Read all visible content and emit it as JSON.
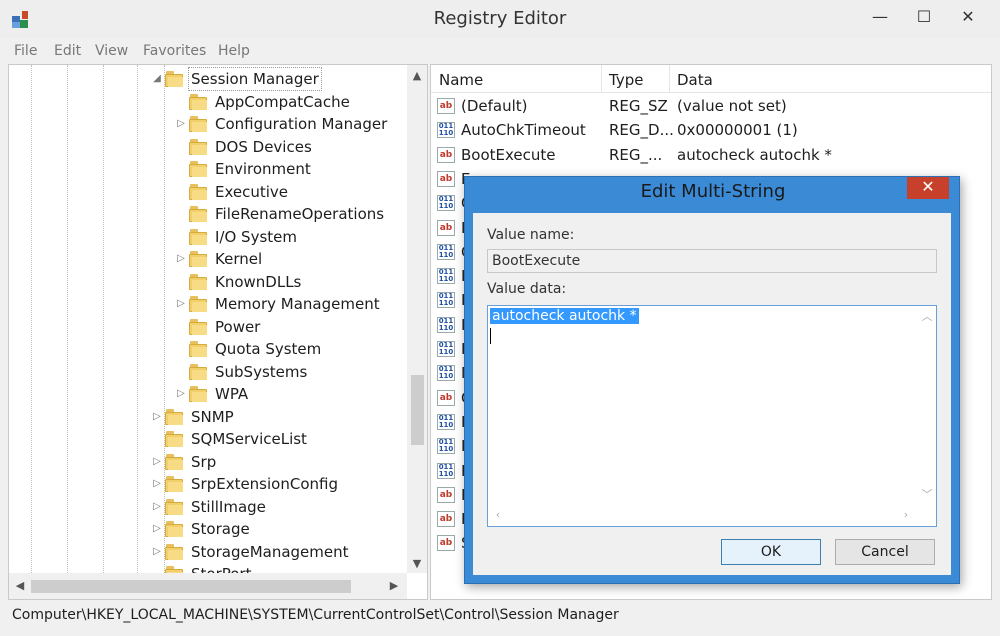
{
  "window": {
    "title": "Registry Editor",
    "minimize_glyph": "—",
    "maximize_glyph": "☐",
    "close_glyph": "✕"
  },
  "menu": [
    "File",
    "Edit",
    "View",
    "Favorites",
    "Help"
  ],
  "tree": {
    "selected": "Session Manager",
    "items": [
      {
        "label": "Session Manager",
        "expanded": true,
        "level": 1
      },
      {
        "label": "AppCompatCache",
        "level": 2,
        "has_children": false
      },
      {
        "label": "Configuration Manager",
        "level": 2,
        "has_children": true
      },
      {
        "label": "DOS Devices",
        "level": 2,
        "has_children": false
      },
      {
        "label": "Environment",
        "level": 2,
        "has_children": false
      },
      {
        "label": "Executive",
        "level": 2,
        "has_children": false
      },
      {
        "label": "FileRenameOperations",
        "level": 2,
        "has_children": false
      },
      {
        "label": "I/O System",
        "level": 2,
        "has_children": false
      },
      {
        "label": "Kernel",
        "level": 2,
        "has_children": true
      },
      {
        "label": "KnownDLLs",
        "level": 2,
        "has_children": false
      },
      {
        "label": "Memory Management",
        "level": 2,
        "has_children": true
      },
      {
        "label": "Power",
        "level": 2,
        "has_children": false
      },
      {
        "label": "Quota System",
        "level": 2,
        "has_children": false
      },
      {
        "label": "SubSystems",
        "level": 2,
        "has_children": false
      },
      {
        "label": "WPA",
        "level": 2,
        "has_children": true
      },
      {
        "label": "SNMP",
        "level": 1,
        "has_children": true
      },
      {
        "label": "SQMServiceList",
        "level": 1,
        "has_children": false
      },
      {
        "label": "Srp",
        "level": 1,
        "has_children": true
      },
      {
        "label": "SrpExtensionConfig",
        "level": 1,
        "has_children": true
      },
      {
        "label": "StillImage",
        "level": 1,
        "has_children": true
      },
      {
        "label": "Storage",
        "level": 1,
        "has_children": true
      },
      {
        "label": "StorageManagement",
        "level": 1,
        "has_children": true
      },
      {
        "label": "StorPort",
        "level": 1,
        "has_children": false
      }
    ]
  },
  "list": {
    "columns": [
      "Name",
      "Type",
      "Data"
    ],
    "rows": [
      {
        "name": "(Default)",
        "type": "REG_SZ",
        "data": "(value not set)",
        "icon": "string-value-icon"
      },
      {
        "name": "AutoChkTimeout",
        "type": "REG_D...",
        "data": "0x00000001 (1)",
        "icon": "binary-value-icon"
      },
      {
        "name": "BootExecute",
        "type": "REG_...",
        "data": "autocheck autochk *",
        "icon": "string-value-icon"
      },
      {
        "name": "E",
        "type": "",
        "data": "",
        "icon": "string-value-icon"
      },
      {
        "name": "C",
        "type": "",
        "data": "",
        "icon": "binary-value-icon"
      },
      {
        "name": "E",
        "type": "",
        "data": "",
        "icon": "string-value-icon"
      },
      {
        "name": "G",
        "type": "",
        "data": "",
        "icon": "binary-value-icon"
      },
      {
        "name": "H",
        "type": "",
        "data": "",
        "icon": "binary-value-icon"
      },
      {
        "name": "H",
        "type": "",
        "data": "",
        "icon": "binary-value-icon"
      },
      {
        "name": "H",
        "type": "",
        "data": "",
        "icon": "binary-value-icon"
      },
      {
        "name": "H",
        "type": "",
        "data": "",
        "icon": "binary-value-icon"
      },
      {
        "name": "N",
        "type": "",
        "data": "",
        "icon": "binary-value-icon"
      },
      {
        "name": "C",
        "type": "",
        "data": "",
        "icon": "string-value-icon"
      },
      {
        "name": "P",
        "type": "",
        "data": "",
        "icon": "binary-value-icon"
      },
      {
        "name": "P",
        "type": "",
        "data": "",
        "icon": "binary-value-icon"
      },
      {
        "name": "R",
        "type": "",
        "data": "",
        "icon": "binary-value-icon"
      },
      {
        "name": "R",
        "type": "",
        "data": "",
        "icon": "string-value-icon"
      },
      {
        "name": "R",
        "type": "",
        "data": "",
        "icon": "string-value-icon"
      },
      {
        "name": "S",
        "type": "",
        "data": "",
        "icon": "string-value-icon"
      }
    ]
  },
  "status": "Computer\\HKEY_LOCAL_MACHINE\\SYSTEM\\CurrentControlSet\\Control\\Session Manager",
  "dialog": {
    "title": "Edit Multi-String",
    "close_glyph": "✕",
    "value_name_label": "Value name:",
    "value_name": "BootExecute",
    "value_data_label": "Value data:",
    "value_data": "autocheck autochk *",
    "ok_label": "OK",
    "cancel_label": "Cancel"
  },
  "colors": {
    "dialog_frame": "#3a8ad6",
    "dialog_close": "#c7402c",
    "selection": "#3399ff",
    "folder": "#f1cf6a"
  }
}
